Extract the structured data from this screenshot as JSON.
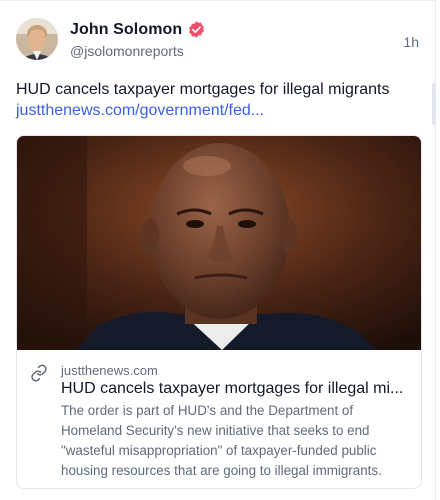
{
  "author": {
    "name": "John Solomon",
    "handle": "@jsolomonreports",
    "avatar_icon": "author-avatar",
    "verified_icon": "verified-badge-icon",
    "verified_color": "#f0506e"
  },
  "post": {
    "timestamp": "1h",
    "text": "HUD cancels taxpayer mortgages for illegal migrants",
    "link_text": "justthenews.com/government/fed..."
  },
  "link_card": {
    "image_icon": "article-photo",
    "link_icon": "link-icon",
    "domain": "justthenews.com",
    "title": "HUD cancels taxpayer mortgages for illegal mi...",
    "description": "The order is part of HUD's and the Department of Homeland Security's new initiative that seeks to end \"wasteful misappropriation\" of taxpayer-funded public housing resources that are going to illegal immigrants."
  },
  "colors": {
    "link": "#3b60e4",
    "muted_text": "#5f6b7a",
    "border": "#e3e6ea"
  }
}
